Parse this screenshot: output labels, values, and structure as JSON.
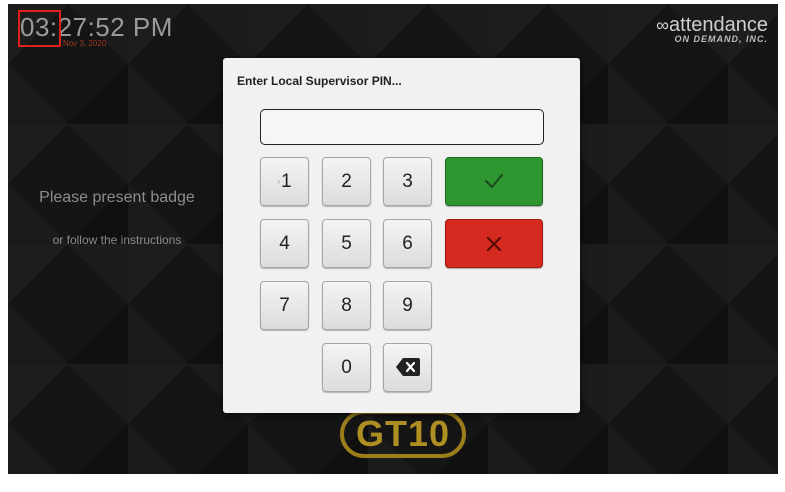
{
  "clock": {
    "time": "03:27:52 PM",
    "date": "Nov 3, 2020"
  },
  "logo": {
    "name": "attendance",
    "tagline": "ON DEMAND, INC.",
    "mark": "∞"
  },
  "prompt": {
    "title": "Please present badge",
    "subtitle": "or follow the instructions"
  },
  "brand_badge": "GT10",
  "dialog": {
    "title": "Enter Local Supervisor PIN...",
    "pin_value": "",
    "keys": [
      "1",
      "2",
      "3",
      "4",
      "5",
      "6",
      "7",
      "8",
      "9",
      "0"
    ],
    "confirm_icon": "check-icon",
    "cancel_icon": "close-icon",
    "backspace_icon": "backspace-icon"
  },
  "colors": {
    "confirm": "#2e962e",
    "cancel": "#d42a1f",
    "highlight": "#e0201a",
    "brand_gold": "#b08f22"
  }
}
